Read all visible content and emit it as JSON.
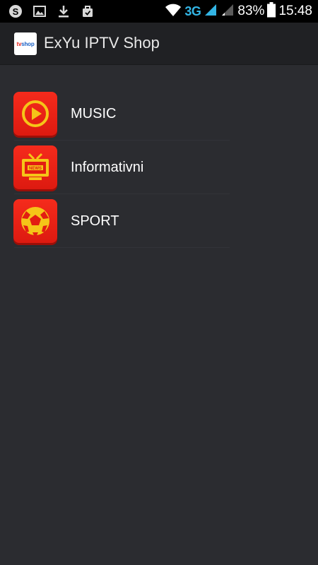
{
  "status_bar": {
    "icons_left": [
      "skype-icon",
      "image-icon",
      "download-icon",
      "bag-icon"
    ],
    "network": "3G",
    "battery_percent": "83%",
    "time": "15:48"
  },
  "app_bar": {
    "title": "ExYu IPTV Shop",
    "logo_text_tv": "tv",
    "logo_text_shop": "shop"
  },
  "categories": [
    {
      "label": "MUSIC",
      "icon": "play-icon"
    },
    {
      "label": "Informativni",
      "icon": "news-tv-icon"
    },
    {
      "label": "SPORT",
      "icon": "soccer-ball-icon"
    }
  ],
  "colors": {
    "background": "#2b2c30",
    "app_bar": "#202124",
    "icon_red": "#ec2316",
    "icon_yellow": "#f5c518",
    "network_blue": "#33b5e5"
  }
}
